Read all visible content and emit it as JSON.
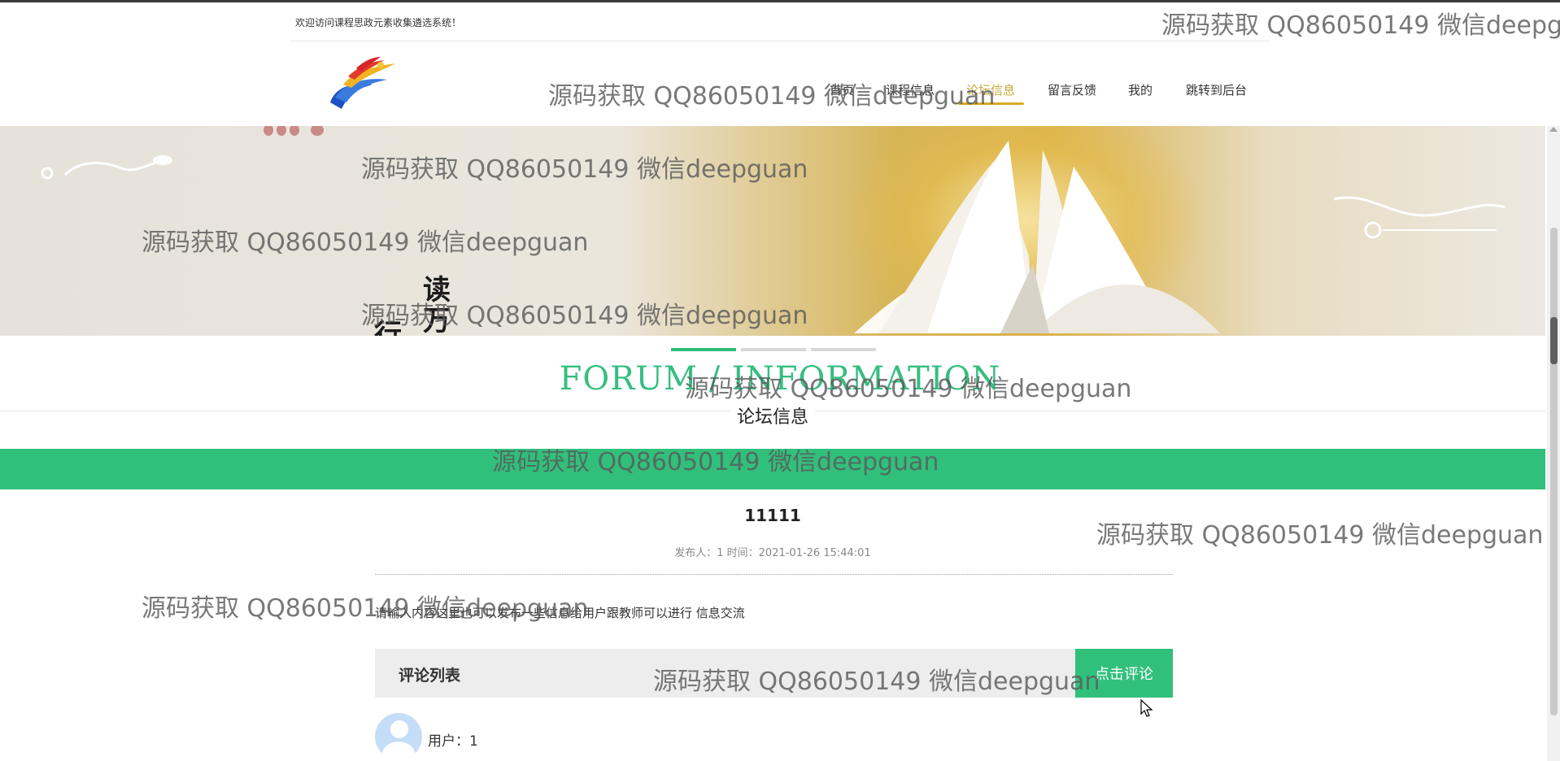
{
  "header": {
    "welcome": "欢迎访问课程思政元素收集遴选系统！"
  },
  "nav": {
    "items": [
      {
        "label": "首页",
        "active": false
      },
      {
        "label": "课程信息",
        "active": false
      },
      {
        "label": "论坛信息",
        "active": true
      },
      {
        "label": "留言反馈",
        "active": false
      },
      {
        "label": "我的",
        "active": false
      },
      {
        "label": "跳转到后台",
        "active": false
      }
    ]
  },
  "banner": {
    "calligraphy_1": "读万卷书",
    "calligraphy_2": "行万里路"
  },
  "section": {
    "title_en": "FORUM / INFORMATION",
    "title_cn": "论坛信息"
  },
  "post": {
    "title": "11111",
    "meta": "发布人：1 时间：2021-01-26 15:44:01",
    "content": "请输入内容这里也可以发布一些信息给用户跟教师可以进行 信息交流"
  },
  "comments": {
    "heading": "评论列表",
    "button_label": "点击评论",
    "items": [
      {
        "user": "用户：1"
      }
    ]
  },
  "watermark": "源码获取 QQ86050149 微信deepguan",
  "colors": {
    "accent_green": "#31c07c",
    "nav_active": "#c8a83a",
    "nav_underline": "#d8ad22"
  }
}
